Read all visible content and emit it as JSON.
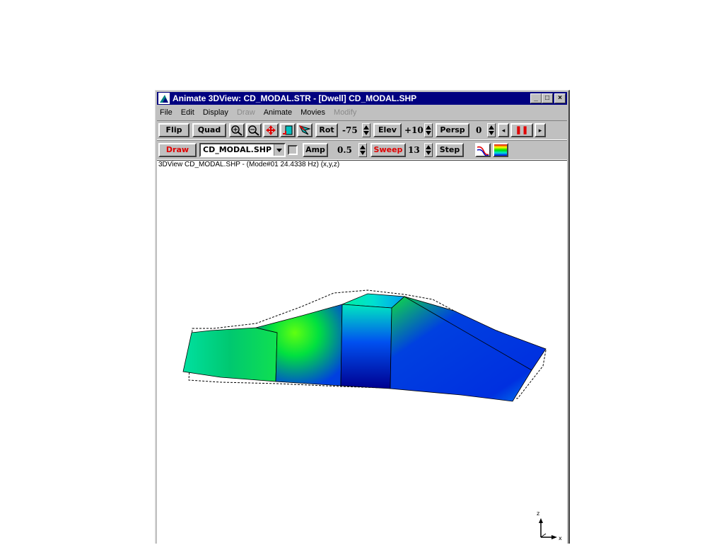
{
  "window": {
    "title": "Animate 3DView: CD_MODAL.STR - [Dwell] CD_MODAL.SHP",
    "controls": {
      "minimize": "_",
      "maximize": "□",
      "close": "×"
    }
  },
  "menu": [
    {
      "label": "File",
      "enabled": true
    },
    {
      "label": "Edit",
      "enabled": true
    },
    {
      "label": "Display",
      "enabled": true
    },
    {
      "label": "Draw",
      "enabled": false
    },
    {
      "label": "Animate",
      "enabled": true
    },
    {
      "label": "Movies",
      "enabled": true
    },
    {
      "label": "Modify",
      "enabled": false
    }
  ],
  "toolbar1": {
    "flip": "Flip",
    "quad": "Quad",
    "rot_label": "Rot",
    "rot_value": "-75",
    "elev_label": "Elev",
    "elev_value": "+10",
    "persp_label": "Persp",
    "persp_value": "0",
    "icons": [
      "zoom-in-icon",
      "zoom-out-icon",
      "move-icon",
      "window-icon",
      "rotate-icon"
    ]
  },
  "toolbar2": {
    "draw": "Draw",
    "shape_file": "CD_MODAL.SHP",
    "amp_label": "Amp",
    "amp_value": "0.5",
    "sweep_label": "Sweep",
    "sweep_value": "13",
    "step_label": "Step"
  },
  "view": {
    "status": "3DView CD_MODAL.SHP - (Mode#01 24.4338 Hz) (x,y,z)",
    "axes": {
      "z": "z",
      "x": "x"
    }
  },
  "colors": {
    "title_bg": "#000080",
    "accent_red": "#e00000",
    "face": "#c0c0c0"
  }
}
